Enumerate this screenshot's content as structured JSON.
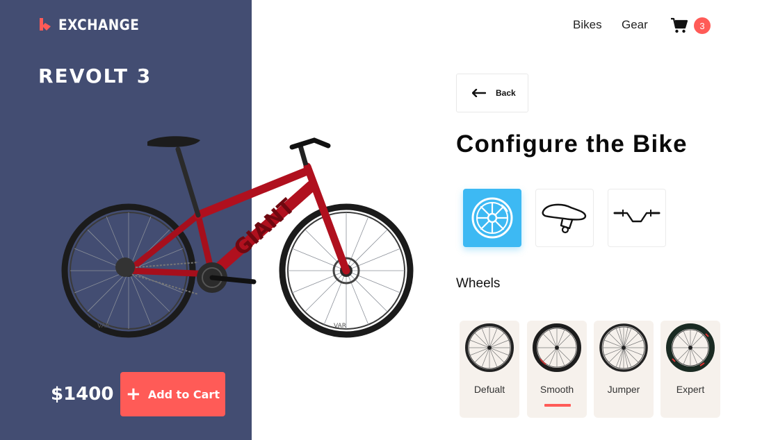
{
  "brand": {
    "name": "EXCHANGE",
    "logo_icon": "brand-logo-icon",
    "accent_color": "#ff5b57"
  },
  "product": {
    "model": "REVOLT 3",
    "price": "$1400",
    "frame_color": "#b0101e"
  },
  "actions": {
    "add_to_cart_label": "Add to Cart",
    "add_icon": "+"
  },
  "nav": {
    "items": [
      {
        "label": "Bikes"
      },
      {
        "label": "Gear"
      }
    ],
    "cart": {
      "icon": "cart-icon",
      "count": "3"
    }
  },
  "config": {
    "back_label": "Back",
    "title": "Configure the Bike",
    "parts": [
      {
        "name": "wheels",
        "icon": "wheel-icon",
        "active": true
      },
      {
        "name": "seat",
        "icon": "saddle-icon",
        "active": false
      },
      {
        "name": "handlebar",
        "icon": "handlebar-icon",
        "active": false
      }
    ],
    "section_label": "Wheels",
    "wheel_options": [
      {
        "label": "Defualt",
        "selected": false
      },
      {
        "label": "Smooth",
        "selected": true
      },
      {
        "label": "Jumper",
        "selected": false
      },
      {
        "label": "Expert",
        "selected": false
      }
    ]
  },
  "colors": {
    "left_panel": "#434d72",
    "active_tile": "#3db9f3",
    "option_bg": "#f6f1ec"
  }
}
